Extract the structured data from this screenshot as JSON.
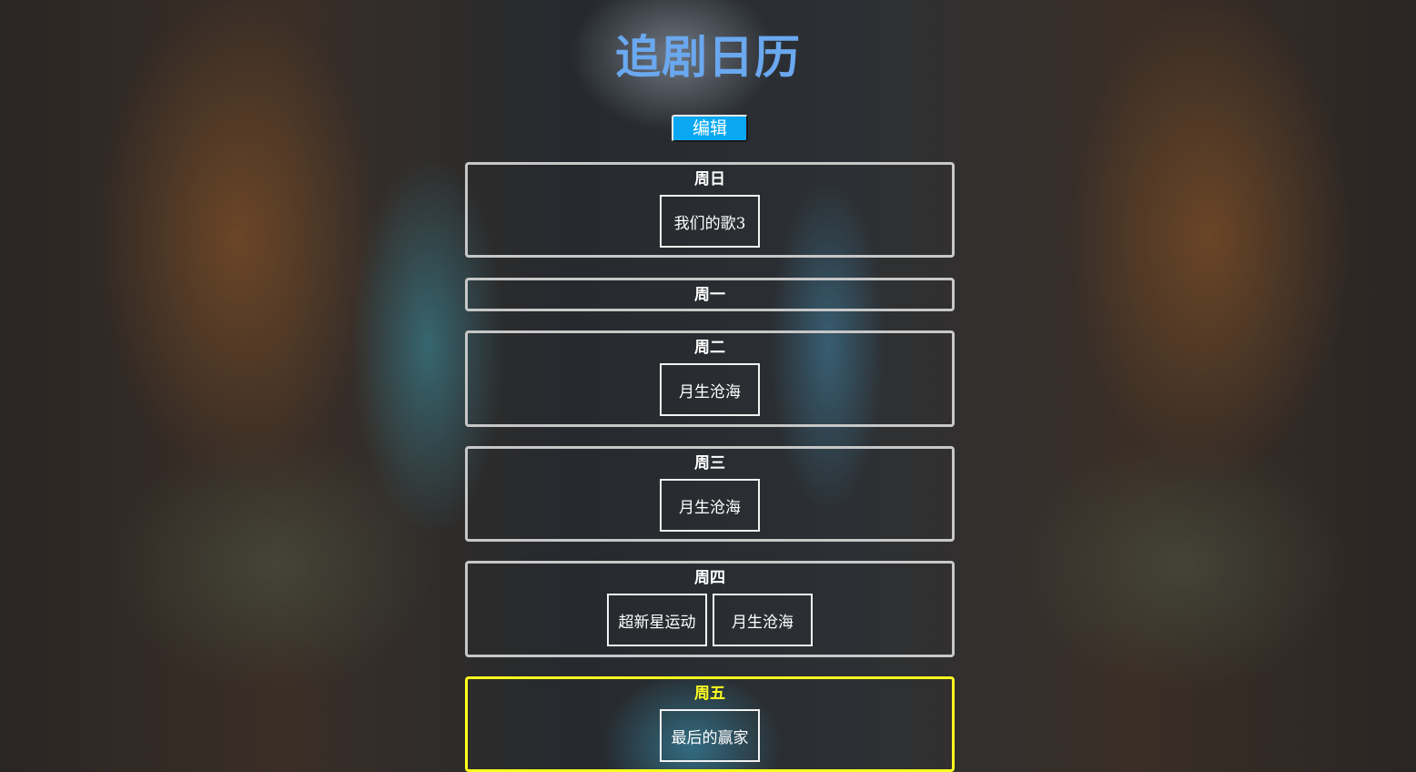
{
  "title": "追剧日历",
  "edit_label": "编辑",
  "days": [
    {
      "name": "周日",
      "shows": [
        "我们的歌3"
      ]
    },
    {
      "name": "周一",
      "shows": []
    },
    {
      "name": "周二",
      "shows": [
        "月生沧海"
      ]
    },
    {
      "name": "周三",
      "shows": [
        "月生沧海"
      ]
    },
    {
      "name": "周四",
      "shows": [
        "超新星运动",
        "月生沧海"
      ]
    },
    {
      "name": "周五",
      "shows": [
        "最后的赢家"
      ]
    }
  ],
  "colors": {
    "title": "#6aa8ef",
    "button": "#0aa8f2",
    "box_border": "#c7c7c7",
    "today_highlight": "#ffff1e"
  }
}
